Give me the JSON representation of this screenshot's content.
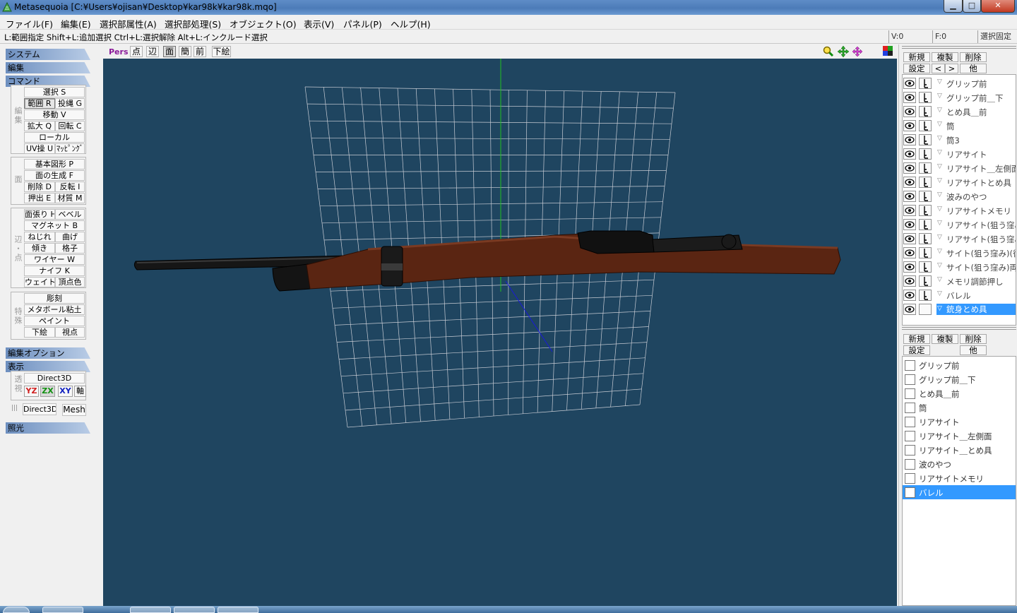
{
  "window": {
    "title": "Metasequoia [C:¥Users¥ojisan¥Desktop¥kar98k¥kar98k.mqo]",
    "min_glyph": "▁",
    "max_glyph": "□",
    "close_glyph": "✕"
  },
  "menu": [
    "ファイル(F)",
    "編集(E)",
    "選択部属性(A)",
    "選択部処理(S)",
    "オブジェクト(O)",
    "表示(V)",
    "パネル(P)",
    "ヘルプ(H)"
  ],
  "status": {
    "hint": "L:範囲指定  Shift+L:追加選択  Ctrl+L:選択解除  Alt+L:インクルード選択",
    "vertices": "V:0",
    "faces": "F:0",
    "select_fixed": "選択固定"
  },
  "left_panel": {
    "system": "システム",
    "edit": "編集",
    "command": "コマンド",
    "edit_option": "編集オプション",
    "display": "表示",
    "lighting": "照光",
    "group_edit": "編集",
    "group_face": "面",
    "group_edge": "辺・点",
    "group_special": "特殊",
    "group_view": "透視",
    "commands": {
      "select": "選択 S",
      "range": "範囲 R",
      "lasso": "投縄 G",
      "move": "移動 V",
      "scale": "拡大 Q",
      "rotate": "回転 C",
      "local": "ローカル",
      "uv": "UV操 U",
      "mapping": "ﾏｯﾋﾟﾝｸﾞ",
      "primitive": "基本図形 P",
      "face_gen": "面の生成 F",
      "delete": "削除 D",
      "flip": "反転 I",
      "extrude": "押出 E",
      "material": "材質 M",
      "knife_h": "面張り H",
      "bevel": "ベベル",
      "magnet": "マグネット B",
      "twist": "ねじれ",
      "bend": "曲げ",
      "tilt": "傾き",
      "lattice": "格子",
      "wire": "ワイヤー W",
      "knife": "ナイフ K",
      "weight": "ウェイト",
      "vcolor": "頂点色",
      "sculpt": "彫刻",
      "metaball": "メタボール粘土",
      "paint": "ペイント",
      "underlay": "下絵",
      "viewpoint": "視点"
    },
    "display_opts": {
      "direct3d_1": "Direct3D",
      "yz": "YZ",
      "zx": "ZX",
      "xy": "XY",
      "axis": "軸",
      "direct3d_2": "Direct3D",
      "mesh": "Mesh",
      "grid_glyph": "|||"
    }
  },
  "view_toolbar": {
    "mode": "Pers",
    "point": "点",
    "edge": "辺",
    "face": "面",
    "simple": "簡",
    "front": "前",
    "underlay": "下絵"
  },
  "object_panel": {
    "new": "新規",
    "copy": "複製",
    "delete": "削除",
    "settings": "設定",
    "prev": "<",
    "next": ">",
    "other": "他",
    "objects": [
      {
        "name": "グリップ前",
        "selected": false
      },
      {
        "name": "グリップ前＿下",
        "selected": false
      },
      {
        "name": "とめ具＿前",
        "selected": false
      },
      {
        "name": "筒",
        "selected": false
      },
      {
        "name": "筒3",
        "selected": false
      },
      {
        "name": "リアサイト",
        "selected": false
      },
      {
        "name": "リアサイト＿左側面",
        "selected": false
      },
      {
        "name": "リアサイトとめ具",
        "selected": false
      },
      {
        "name": "波みのやつ",
        "selected": false
      },
      {
        "name": "リアサイトメモリ",
        "selected": false
      },
      {
        "name": "リアサイト(狙う窪み)",
        "selected": false
      },
      {
        "name": "リアサイト(狙う窪み)",
        "selected": false
      },
      {
        "name": "サイト(狙う窪み)(後ろ",
        "selected": false
      },
      {
        "name": "サイト(狙う窪み)両サ",
        "selected": false
      },
      {
        "name": "メモリ調節押し",
        "selected": false
      },
      {
        "name": "バレル",
        "selected": false
      },
      {
        "name": "銃身とめ具",
        "selected": true
      }
    ]
  },
  "material_panel": {
    "new": "新規",
    "copy": "複製",
    "delete": "削除",
    "settings": "設定",
    "other": "他",
    "materials": [
      {
        "name": "グリップ前",
        "selected": false
      },
      {
        "name": "グリップ前＿下",
        "selected": false
      },
      {
        "name": "とめ具＿前",
        "selected": false
      },
      {
        "name": "筒",
        "selected": false
      },
      {
        "name": "リアサイト",
        "selected": false
      },
      {
        "name": "リアサイト＿左側面",
        "selected": false
      },
      {
        "name": "リアサイト＿とめ具",
        "selected": false
      },
      {
        "name": "波のやつ",
        "selected": false
      },
      {
        "name": "リアサイトメモリ",
        "selected": false
      },
      {
        "name": "バレル",
        "selected": true
      }
    ]
  },
  "colors": {
    "viewport_bg": "#1f4560",
    "grid": "#c8ccd4",
    "stock": "#5a2512",
    "metal": "#151515",
    "selection": "#3399ff"
  }
}
